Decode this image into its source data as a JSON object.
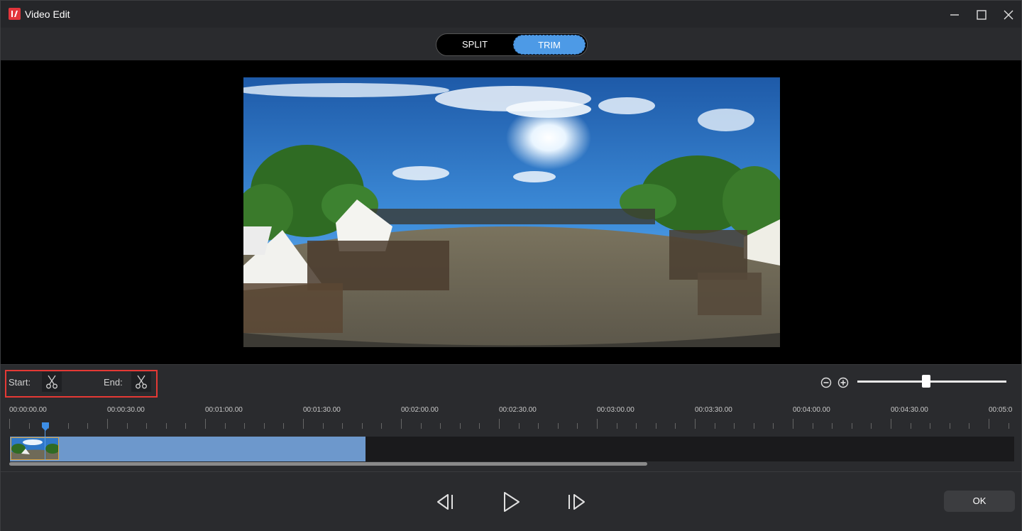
{
  "window": {
    "title": "Video Edit",
    "controls": [
      "minimize-icon",
      "maximize-icon",
      "close-icon"
    ]
  },
  "mode_toggle": {
    "tabs": [
      {
        "label": "SPLIT",
        "active": false
      },
      {
        "label": "TRIM",
        "active": true
      }
    ],
    "active_color": "#4d9ae6"
  },
  "trim_controls": {
    "start_label": "Start:",
    "end_label": "End:",
    "highlight_color": "#e53935",
    "zoom_level": 0.46
  },
  "timeline": {
    "ruler": [
      "00:00:00.00",
      "00:00:30.00",
      "00:01:00.00",
      "00:01:30.00",
      "00:02:00.00",
      "00:02:30.00",
      "00:03:00.00",
      "00:03:30.00",
      "00:04:00.00",
      "00:04:30.00",
      "00:05:0"
    ],
    "clip_color": "#6d98cc",
    "playhead_color": "#3d8ee6"
  },
  "playback": {
    "prev_icon": "previous-frame-icon",
    "play_icon": "play-icon",
    "next_icon": "next-frame-icon",
    "ok_label": "OK"
  }
}
